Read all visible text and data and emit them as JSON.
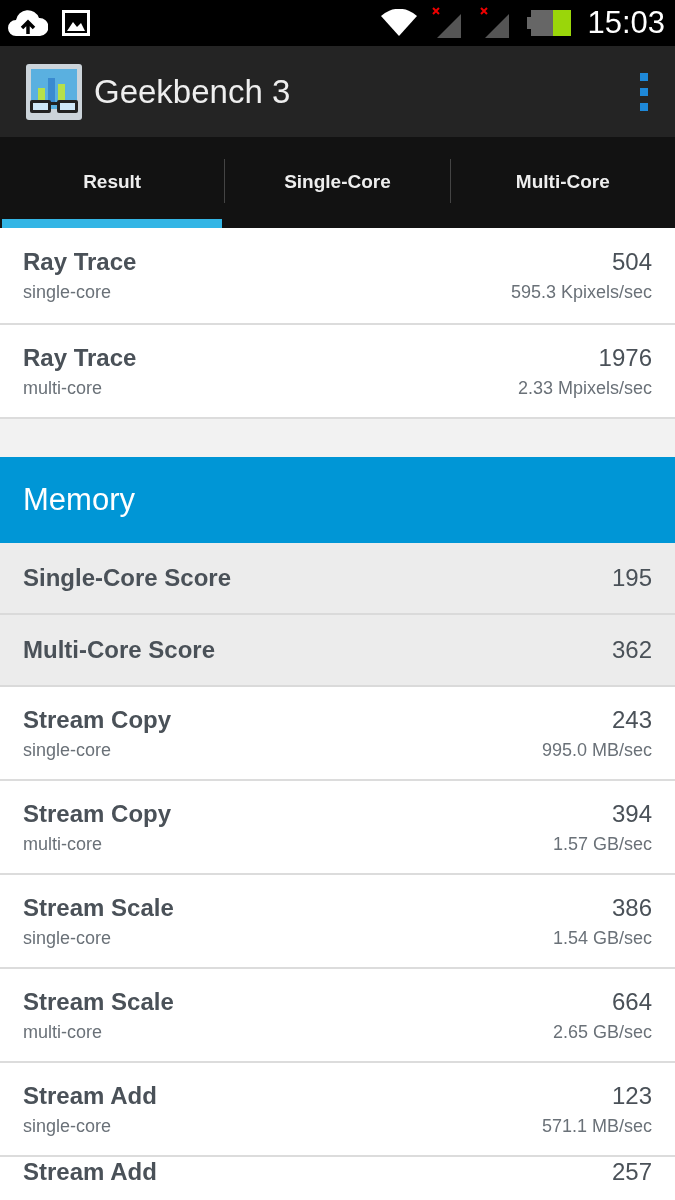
{
  "status_bar": {
    "time": "15:03"
  },
  "app_bar": {
    "title": "Geekbench 3"
  },
  "tabs": [
    {
      "label": "Result",
      "selected": true
    },
    {
      "label": "Single-Core",
      "selected": false
    },
    {
      "label": "Multi-Core",
      "selected": false
    }
  ],
  "rows": [
    {
      "kind": "benchmark",
      "name": "Ray Trace",
      "mode": "single-core",
      "score": "504",
      "rate": "595.3 Kpixels/sec"
    },
    {
      "kind": "benchmark",
      "name": "Ray Trace",
      "mode": "multi-core",
      "score": "1976",
      "rate": "2.33 Mpixels/sec"
    },
    {
      "kind": "gap"
    },
    {
      "kind": "header",
      "name": "Memory"
    },
    {
      "kind": "score",
      "name": "Single-Core Score",
      "score": "195"
    },
    {
      "kind": "score",
      "name": "Multi-Core Score",
      "score": "362"
    },
    {
      "kind": "benchmark",
      "name": "Stream Copy",
      "mode": "single-core",
      "score": "243",
      "rate": "995.0 MB/sec"
    },
    {
      "kind": "benchmark",
      "name": "Stream Copy",
      "mode": "multi-core",
      "score": "394",
      "rate": "1.57 GB/sec"
    },
    {
      "kind": "benchmark",
      "name": "Stream Scale",
      "mode": "single-core",
      "score": "386",
      "rate": "1.54 GB/sec"
    },
    {
      "kind": "benchmark",
      "name": "Stream Scale",
      "mode": "multi-core",
      "score": "664",
      "rate": "2.65 GB/sec"
    },
    {
      "kind": "benchmark",
      "name": "Stream Add",
      "mode": "single-core",
      "score": "123",
      "rate": "571.1 MB/sec"
    },
    {
      "kind": "partial",
      "name": "Stream Add",
      "score": "257"
    }
  ]
}
